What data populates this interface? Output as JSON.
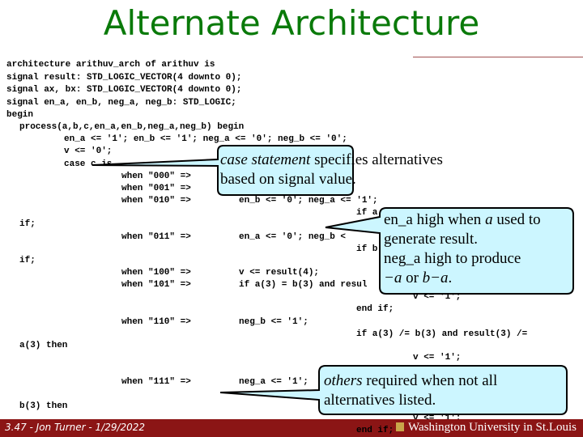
{
  "title": "Alternate Architecture",
  "code_lines": [
    "architecture arithuv_arch of arithuv is",
    "signal result: STD_LOGIC_VECTOR(4 downto 0);",
    "signal ax, bx: STD_LOGIC_VECTOR(4 downto 0);",
    "signal en_a, en_b, neg_a, neg_b: STD_LOGIC;",
    "begin",
    "process(a,b,c,en_a,en_b,neg_a,neg_b) begin",
    "en_a <= '1'; en_b <= '1'; neg_a <= '0'; neg_b <= '0';",
    "v <= '0';",
    "case c is",
    "when \"000\" =>",
    "when \"001\" =>",
    "when \"010\" =>",
    "en_b <= '0'; neg_a <= '1';",
    "if a",
    "if;",
    "when \"011\" =>",
    "en_a <= '0'; neg_b <",
    "if b",
    "if;",
    "when \"100\" =>",
    "v <= result(4);",
    "when \"101\" =>",
    "if a(3) = b(3) and resul",
    "v <= '1';",
    "end if;",
    "when \"110\" =>",
    "neg_b <= '1';",
    "if a(3) /= b(3) and result(3) /=",
    "a(3) then",
    "v <= '1';",
    "when \"111\" =>",
    "neg_a <= '1';",
    "b(3) then",
    "v <= '1';",
    "end if;"
  ],
  "callouts": {
    "case": {
      "em": "case statement",
      "rest1": " specifies alternatives",
      "line2": "based on signal value."
    },
    "en_a": {
      "line1a": "en_a high when ",
      "line1em": "a",
      "line1b": " used to",
      "line2": "generate result.",
      "line3": "neg_a high to produce",
      "line4em1": "−a",
      "line4mid": " or ",
      "line4em2": "b−a",
      "line4end": "."
    },
    "others": {
      "em": "others",
      "rest1": " required when not all",
      "line2": "alternatives listed."
    }
  },
  "footer": {
    "left": "3.47 - Jon Turner - 1/29/2022",
    "right": "Washington University in St.Louis"
  },
  "colors": {
    "title": "#0a7a0a",
    "callout_fill": "#ccf6ff",
    "footer": "#8b1515"
  }
}
